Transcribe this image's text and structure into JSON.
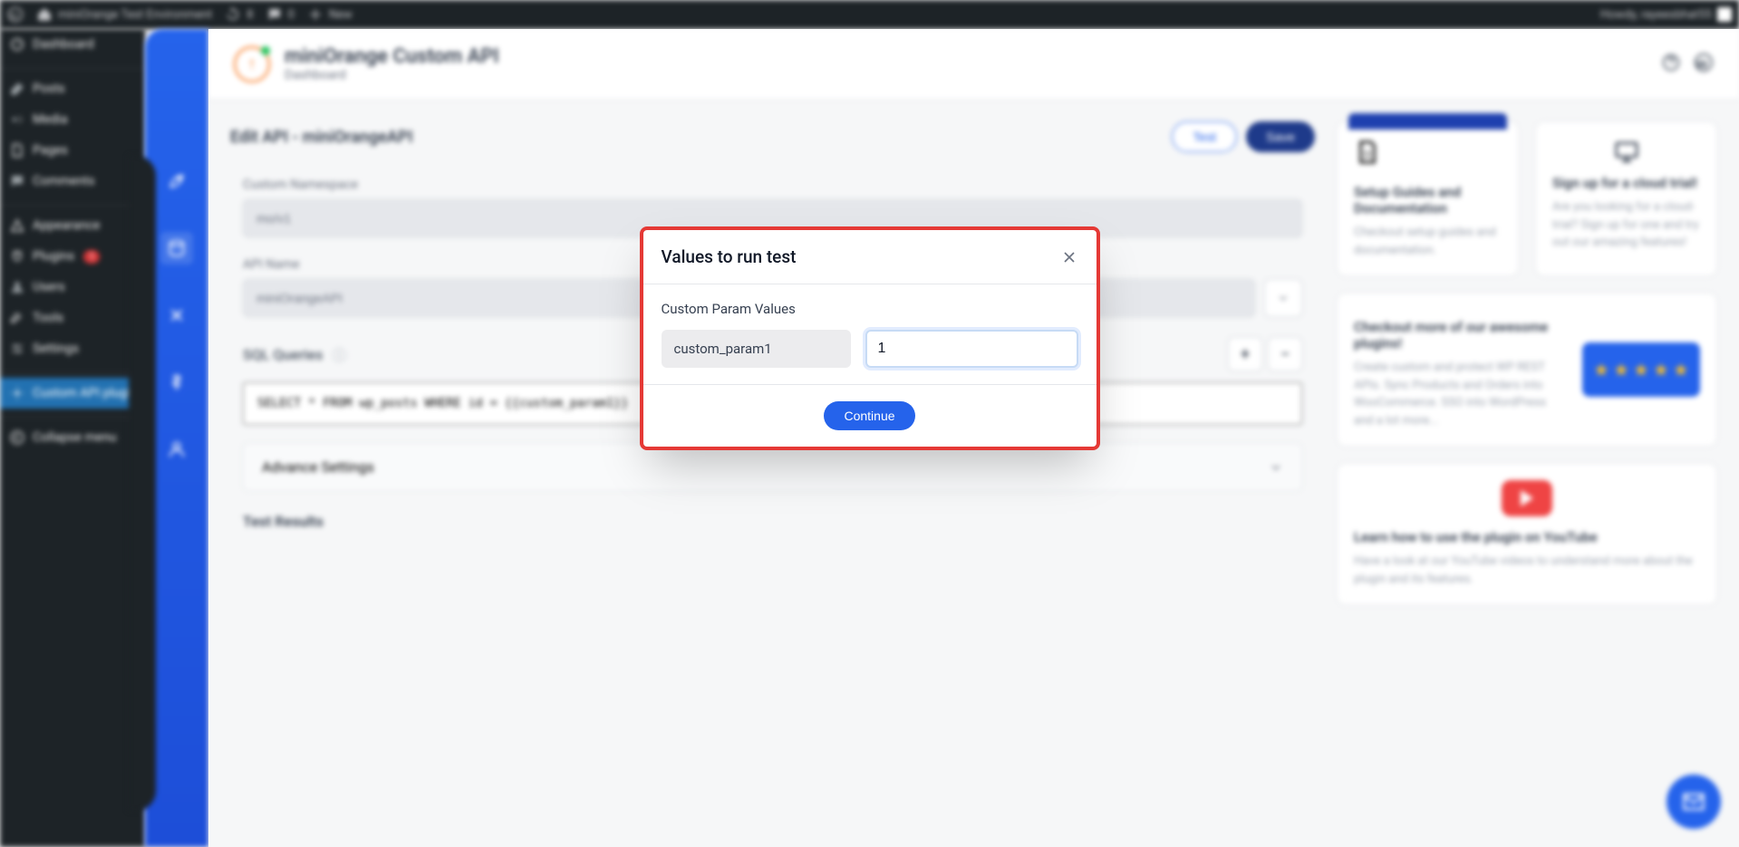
{
  "adminBar": {
    "siteTitle": "miniOrange Test Environment",
    "updatesCount": "8",
    "commentsCount": "0",
    "newLabel": "New",
    "howdy": "Howdy, rayeesbhat55"
  },
  "wpMenu": {
    "dashboard": "Dashboard",
    "posts": "Posts",
    "media": "Media",
    "pages": "Pages",
    "comments": "Comments",
    "appearance": "Appearance",
    "plugins": "Plugins",
    "pluginsBadge": "1",
    "users": "Users",
    "tools": "Tools",
    "settings": "Settings",
    "customApi": "Custom API plugin",
    "collapse": "Collapse menu"
  },
  "header": {
    "title": "miniOrange Custom API",
    "subtitle": "Dashboard"
  },
  "page": {
    "editTitle": "Edit API - miniOrangeAPI",
    "testBtn": "Test",
    "saveBtn": "Save",
    "nsLabel": "Custom Namespace",
    "nsValue": "mo/v1",
    "apiNameLabel": "API Name",
    "apiNameValue": "miniOrangeAPI",
    "sqlLabel": "SQL Queries",
    "sqlValue": "SELECT * FROM wp_posts WHERE id = {{custom_param1}}",
    "advance": "Advance Settings",
    "results": "Test Results"
  },
  "cards": {
    "setupTitle": "Setup Guides and Documentation",
    "setupText": "Checkout setup guides and documentation.",
    "trialTitle": "Sign up for a cloud trial!",
    "trialText": "Are you looking for a cloud-trial? Sign up for one and try out our amazing features!",
    "pluginsTitle": "Checkout more of our awesome plugins!",
    "pluginsText": "Create custom and protect WP REST APIs. Sync Products and Orders into WooCommerce. SSO into WordPress and a lot more...",
    "youtubeTitle": "Learn how to use the plugin on YouTube",
    "youtubeText": "Have a look at our YouTube videos to understand more about the plugin and its features."
  },
  "modal": {
    "title": "Values to run test",
    "subtitle": "Custom Param Values",
    "paramName": "custom_param1",
    "paramValue": "1",
    "continueBtn": "Continue"
  }
}
